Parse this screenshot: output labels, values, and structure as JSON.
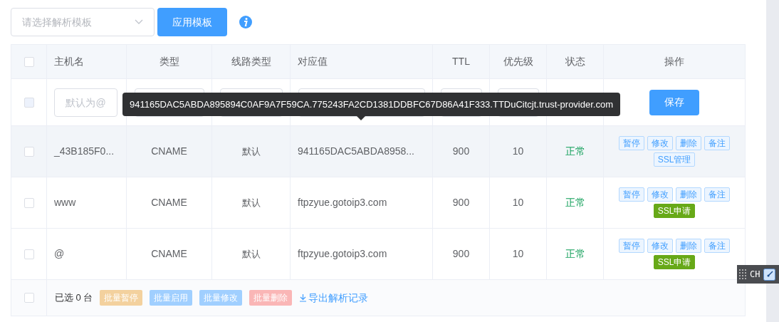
{
  "toolbar": {
    "template_select": {
      "placeholder": "请选择解析模板"
    },
    "apply_button": "应用模板"
  },
  "table": {
    "header_checkbox": {
      "checked": false
    },
    "columns": [
      "主机名",
      "类型",
      "线路类型",
      "对应值",
      "TTL",
      "优先级",
      "状态",
      "操作"
    ],
    "edit_row": {
      "checkbox": {
        "checked": false,
        "disabled": true
      },
      "hostname": {
        "placeholder": "默认为@"
      },
      "save_button": "保存"
    },
    "rows": [
      {
        "checked": false,
        "highlighted": true,
        "hostname": "_43B185F0...",
        "type": "CNAME",
        "line": "默认",
        "value": "941165DAC5ABDA8958...",
        "ttl": "900",
        "priority": "10",
        "status": "正常",
        "actions": [
          "暂停",
          "修改",
          "删除",
          "备注"
        ],
        "ssl_button": {
          "label": "SSL管理",
          "kind": "manage"
        }
      },
      {
        "checked": false,
        "highlighted": false,
        "hostname": "www",
        "type": "CNAME",
        "line": "默认",
        "value": "ftpzyue.gotoip3.com",
        "ttl": "900",
        "priority": "10",
        "status": "正常",
        "actions": [
          "暂停",
          "修改",
          "删除",
          "备注"
        ],
        "ssl_button": {
          "label": "SSL申请",
          "kind": "apply"
        }
      },
      {
        "checked": false,
        "highlighted": false,
        "hostname": "@",
        "type": "CNAME",
        "line": "默认",
        "value": "ftpzyue.gotoip3.com",
        "ttl": "900",
        "priority": "10",
        "status": "正常",
        "actions": [
          "暂停",
          "修改",
          "删除",
          "备注"
        ],
        "ssl_button": {
          "label": "SSL申请",
          "kind": "apply"
        }
      }
    ],
    "footer": {
      "checkbox": {
        "checked": false
      },
      "selected_count": "已选 0 台",
      "batch_buttons": [
        {
          "label": "批量暂停",
          "color": "#f3d19e"
        },
        {
          "label": "批量启用",
          "color": "#a0cfff"
        },
        {
          "label": "批量修改",
          "color": "#a0cfff"
        },
        {
          "label": "批量删除",
          "color": "#fab6b6"
        }
      ],
      "export_link": "导出解析记录"
    }
  },
  "tooltip": "941165DAC5ABDA895894C0AF9A7F59CA.775243FA2CD1381DDBFC67D86A41F333.TTDuCitcjt.trust-provider.com",
  "ime_bar": {
    "label": "CH"
  }
}
